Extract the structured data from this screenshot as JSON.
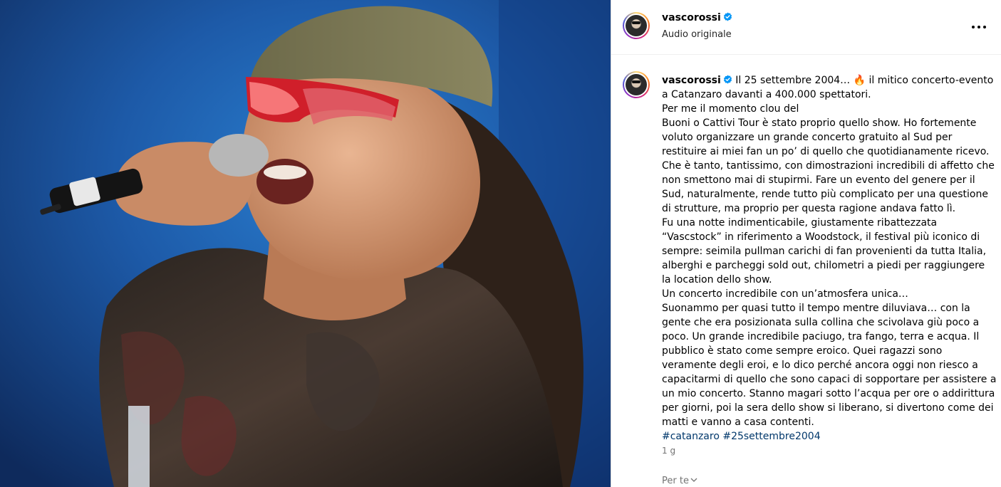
{
  "post": {
    "username": "vascorossi",
    "audio_label": "Audio originale",
    "caption_user": "vascorossi",
    "caption_lines": [
      "Il 25 settembre 2004… 🔥 il mitico concerto-evento a Catanzaro davanti a 400.000 spettatori.",
      "Per me il momento clou del",
      "Buoni o Cattivi Tour è stato proprio quello show. Ho fortemente voluto organizzare un grande concerto gratuito al Sud per restituire ai miei fan un po’ di quello che quotidianamente ricevo. Che è tanto, tantissimo, con dimostrazioni incredibili di affetto che non smettono mai di stupirmi. Fare un evento del genere per il Sud, naturalmente, rende tutto più complicato per una questione di strutture, ma proprio per questa ragione andava fatto lì.",
      "Fu una notte indimenticabile, giustamente ribattezzata “Vascstock” in riferimento a Woodstock, il festival più iconico di sempre: seimila pullman carichi di fan provenienti da tutta Italia, alberghi e parcheggi sold out, chilometri a piedi per raggiungere la location dello show.",
      "Un concerto incredibile con un’atmosfera unica…",
      "Suonammo per quasi tutto il tempo mentre diluviava… con la gente che era posizionata sulla collina che scivolava giù poco a poco. Un grande incredibile paciugo, tra fango, terra e acqua. Il pubblico è stato come sempre eroico. Quei ragazzi sono veramente degli eroi, e lo dico perché ancora oggi non riesco a capacitarmi di quello che sono capaci di sopportare per assistere a un mio concerto. Stanno magari sotto l’acqua per ore o addirittura per giorni, poi la sera dello show si liberano, si divertono come dei matti e vanno a casa contenti."
    ],
    "hashtags": [
      "#catanzaro",
      "#25settembre2004"
    ],
    "time_ago": "1 g",
    "for_you_label": "Per te"
  },
  "colors": {
    "verified": "#0095f6",
    "hashtag": "#00376b",
    "muted": "#737373"
  },
  "icons": {
    "verified": "verified-badge-icon",
    "more": "more-options-icon",
    "chevron": "chevron-down-icon"
  }
}
